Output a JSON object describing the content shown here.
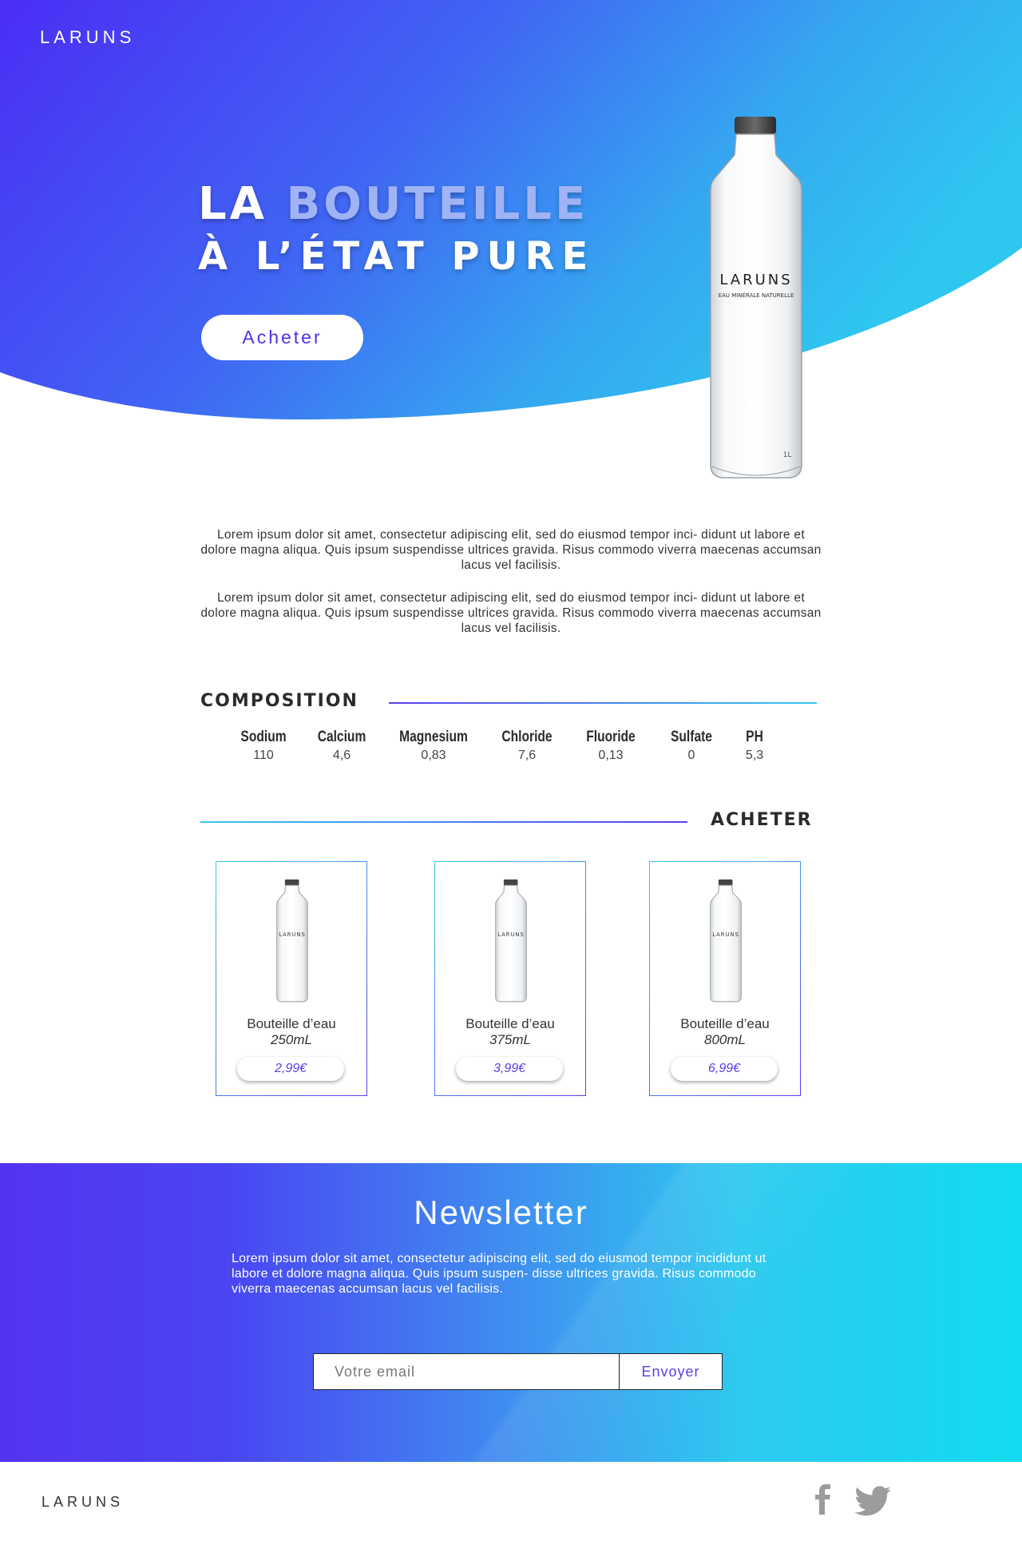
{
  "brand": "LARUNS",
  "colors": {
    "hero_gradient_start": "#4a2ef5",
    "hero_gradient_end": "#2fc6f0",
    "accent_purple": "#5a3fe6",
    "accent_cyan": "#36c8ee",
    "title_highlight": "#9fb3f5"
  },
  "hero": {
    "title_prefix": "LA ",
    "title_highlight": "BOUTEILLE",
    "subtitle": "À L’ÉTAT PURE",
    "cta_label": "Acheter",
    "bottle": {
      "brand": "LARUNS",
      "tagline": "EAU MINÉRALE NATURELLE",
      "volume": "1L"
    }
  },
  "intro": {
    "paragraphs": [
      "Lorem ipsum dolor sit amet, consectetur adipiscing elit, sed do eiusmod tempor inci- didunt ut labore et dolore magna aliqua. Quis ipsum suspendisse ultrices gravida. Risus commodo viverra maecenas accumsan lacus vel facilisis.",
      "Lorem ipsum dolor sit amet, consectetur adipiscing elit, sed do eiusmod tempor inci- didunt ut labore et dolore magna aliqua. Quis ipsum suspendisse ultrices gravida. Risus commodo viverra maecenas accumsan lacus vel facilisis."
    ]
  },
  "composition": {
    "heading": "COMPOSITION",
    "items": [
      {
        "name": "Sodium",
        "value": "110"
      },
      {
        "name": "Calcium",
        "value": "4,6"
      },
      {
        "name": "Magnesium",
        "value": "0,83"
      },
      {
        "name": "Chloride",
        "value": "7,6"
      },
      {
        "name": "Fluoride",
        "value": "0,13"
      },
      {
        "name": "Sulfate",
        "value": "0"
      },
      {
        "name": "PH",
        "value": "5,3"
      }
    ]
  },
  "shop": {
    "heading": "ACHETER",
    "products": [
      {
        "name": "Bouteille d’eau",
        "size": "250mL",
        "price": "2,99€"
      },
      {
        "name": "Bouteille d’eau",
        "size": "375mL",
        "price": "3,99€"
      },
      {
        "name": "Bouteille d’eau",
        "size": "800mL",
        "price": "6,99€"
      }
    ]
  },
  "newsletter": {
    "title": "Newsletter",
    "text": "Lorem ipsum dolor sit amet, consectetur adipiscing elit, sed do eiusmod tempor incididunt ut labore et dolore magna aliqua. Quis ipsum suspen- disse ultrices gravida. Risus commodo viverra maecenas accumsan lacus vel facilisis.",
    "email_placeholder": "Votre email",
    "submit_label": "Envoyer"
  },
  "footer": {
    "brand": "LARUNS",
    "social": [
      "facebook-icon",
      "twitter-icon"
    ]
  }
}
